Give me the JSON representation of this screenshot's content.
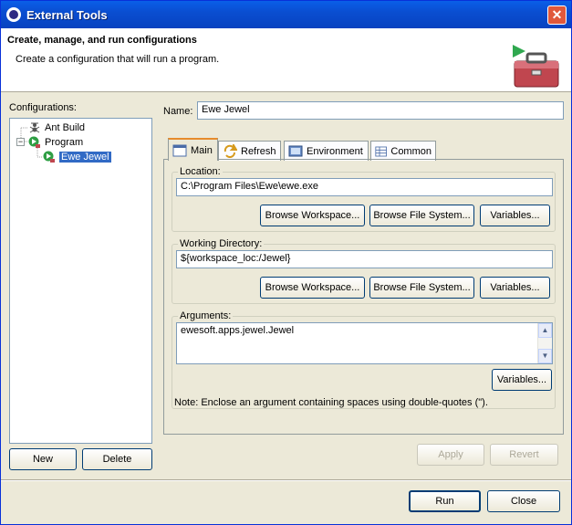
{
  "window": {
    "title": "External Tools",
    "close_glyph": "✕"
  },
  "banner": {
    "heading": "Create, manage, and run configurations",
    "description": "Create a configuration that will run a program."
  },
  "configurations": {
    "label": "Configurations:",
    "tree": [
      {
        "label": "Ant Build",
        "icon": "ant-build-icon"
      },
      {
        "label": "Program",
        "icon": "program-icon",
        "expanded": true,
        "expander": "−"
      },
      {
        "label": "Ewe Jewel",
        "icon": "program-config-icon",
        "selected": true
      }
    ],
    "new_label": "New",
    "delete_label": "Delete"
  },
  "name": {
    "label": "Name:",
    "value": "Ewe Jewel"
  },
  "tabs": [
    {
      "label": "Main",
      "icon": "main-tab-icon",
      "active": true
    },
    {
      "label": "Refresh",
      "icon": "refresh-icon"
    },
    {
      "label": "Environment",
      "icon": "environment-icon"
    },
    {
      "label": "Common",
      "icon": "common-icon"
    }
  ],
  "main": {
    "location": {
      "label": "Location:",
      "value": "C:\\Program Files\\Ewe\\ewe.exe",
      "browse_workspace": "Browse Workspace...",
      "browse_file_system": "Browse File System...",
      "variables": "Variables..."
    },
    "working_directory": {
      "label": "Working Directory:",
      "value": "${workspace_loc:/Jewel}",
      "browse_workspace": "Browse Workspace...",
      "browse_file_system": "Browse File System...",
      "variables": "Variables..."
    },
    "arguments": {
      "label": "Arguments:",
      "value": "ewesoft.apps.jewel.Jewel",
      "variables": "Variables...",
      "note": "Note: Enclose an argument containing spaces using double-quotes (\")."
    }
  },
  "actions": {
    "apply": "Apply",
    "revert": "Revert"
  },
  "footer": {
    "run": "Run",
    "close": "Close"
  },
  "colors": {
    "titlebar": "#0a4ed1",
    "selection": "#316ac5",
    "tab_accent": "#e68b2c",
    "window_bg": "#ece9d8"
  }
}
